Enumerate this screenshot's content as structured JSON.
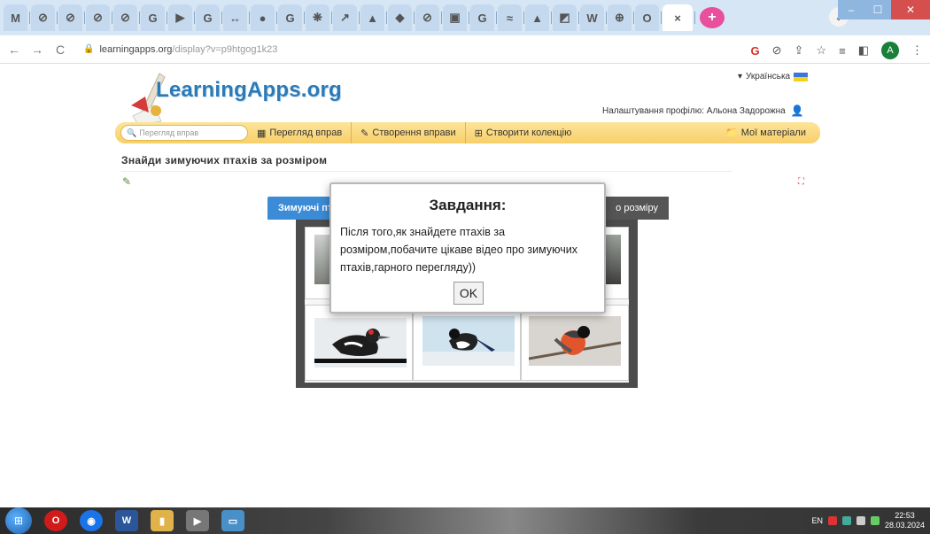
{
  "browser": {
    "tabs": [
      "M",
      "⊘",
      "⊘",
      "⊘",
      "⊘",
      "G",
      "▶",
      "G",
      "↔",
      "●",
      "G",
      "❋",
      "↗",
      "▲",
      "◆",
      "⊘",
      "▣",
      "G",
      "≈",
      "▲",
      "◩",
      "W",
      "⊕",
      "O",
      "×"
    ],
    "new_tab": "+",
    "tab_menu": "⌄",
    "url_domain": "learningapps.org",
    "url_path": "/display?v=p9htgog1k23",
    "avatar_letter": "A"
  },
  "site": {
    "logo": "LearningApps.org",
    "language": "Українська",
    "profile_label": "Налаштування профілю: Альона Задорожна",
    "search_placeholder": "Перегляд вправ",
    "menu": {
      "browse": "Перегляд вправ",
      "create": "Створення вправи",
      "collection": "Створити колекцію",
      "my_materials": "Мої матеріали"
    },
    "page_title": "Знайди зимуючих птахів за розміром"
  },
  "app": {
    "left_label": "Зимуючі птахи",
    "right_label": "о розміру"
  },
  "dialog": {
    "title": "Завдання:",
    "text": "Після того,як знайдете птахів за розміром,побачите цікаве відео про зимуючих птахів,гарного перегляду))",
    "ok": "OK"
  },
  "taskbar": {
    "lang": "EN",
    "time": "22:53",
    "date": "28.03.2024"
  }
}
